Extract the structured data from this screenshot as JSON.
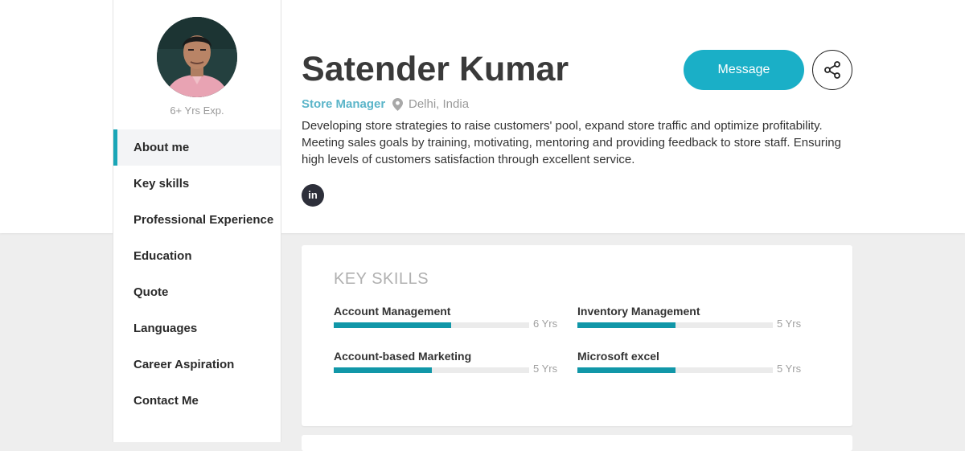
{
  "profile": {
    "name": "Satender Kumar",
    "experience": "6+ Yrs Exp.",
    "role": "Store Manager",
    "location": "Delhi, India",
    "bio": "Developing store strategies to raise customers' pool, expand store traffic and optimize profitability. Meeting sales goals by training, motivating, mentoring and providing feedback to store staff. Ensuring high levels of customers satisfaction through excellent service.",
    "linkedin_glyph": "in"
  },
  "actions": {
    "message_label": "Message",
    "share_icon": "share-icon"
  },
  "nav": {
    "items": [
      {
        "label": "About me",
        "active": true
      },
      {
        "label": "Key skills"
      },
      {
        "label": "Professional Experience"
      },
      {
        "label": "Education"
      },
      {
        "label": "Quote"
      },
      {
        "label": "Languages"
      },
      {
        "label": "Career Aspiration"
      },
      {
        "label": "Contact Me"
      }
    ]
  },
  "skills_section": {
    "title": "KEY SKILLS",
    "skills": [
      {
        "name": "Account Management",
        "years": "6 Yrs",
        "level": 0.6
      },
      {
        "name": "Inventory Management",
        "years": "5 Yrs",
        "level": 0.5
      },
      {
        "name": "Account-based Marketing",
        "years": "5 Yrs",
        "level": 0.5
      },
      {
        "name": "Microsoft excel",
        "years": "5 Yrs",
        "level": 0.5
      }
    ]
  },
  "colors": {
    "accent": "#1aafc7",
    "bar": "#1197a8",
    "role": "#5bb5c9"
  }
}
